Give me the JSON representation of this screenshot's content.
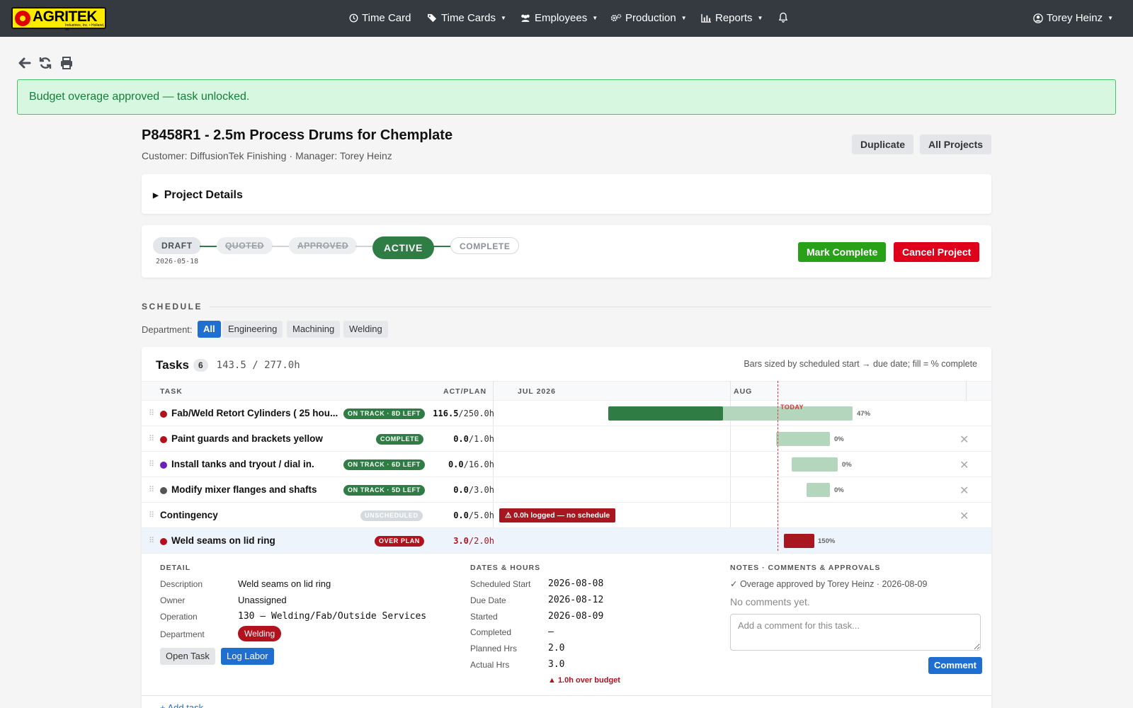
{
  "app": {
    "brand": "AGRITEK",
    "brand_tagline": "Industries, Inc. • Holland, MI"
  },
  "nav": {
    "items": [
      {
        "label": "Time Card",
        "icon": "clock-icon",
        "has_caret": false
      },
      {
        "label": "Time Cards",
        "icon": "tags-icon",
        "has_caret": true
      },
      {
        "label": "Employees",
        "icon": "users-icon",
        "has_caret": true
      },
      {
        "label": "Production",
        "icon": "gears-icon",
        "has_caret": true
      },
      {
        "label": "Reports",
        "icon": "bar-chart-icon",
        "has_caret": true
      }
    ],
    "user": "Torey Heinz"
  },
  "alert": {
    "message": "Budget overage approved — task unlocked.",
    "color": "#167d3a"
  },
  "project": {
    "title": "P8458R1 - 2.5m Process Drums for Chemplate",
    "customer_label": "Customer: DiffusionTek Finishing",
    "separator": "·",
    "manager_label": "Manager: Torey Heinz",
    "duplicate_label": "Duplicate",
    "all_projects_label": "All Projects",
    "details_label": "Project Details"
  },
  "status": {
    "stages": [
      "DRAFT",
      "QUOTED",
      "APPROVED",
      "ACTIVE",
      "COMPLETE"
    ],
    "current": "ACTIVE",
    "draft_date": "2026-05-18",
    "mark_complete_label": "Mark Complete",
    "cancel_label": "Cancel Project"
  },
  "schedule": {
    "heading": "SCHEDULE",
    "department_label": "Department:",
    "departments": [
      "All",
      "Engineering",
      "Machining",
      "Welding"
    ],
    "selected_department": "All"
  },
  "tasks": {
    "title": "Tasks",
    "count": "6",
    "hours_total": "143.5 / 277.0h",
    "bars_note": "Bars sized by scheduled start → due date; fill = % complete",
    "col_task": "TASK",
    "col_act_plan": "ACT/PLAN",
    "months": [
      "JUL 2026",
      "AUG"
    ],
    "today_label": "TODAY",
    "rows": [
      {
        "name": "Fab/Weld Retort Cylinders ( 25 hou...",
        "dot_color": "#b1121d",
        "badge": "ON TRACK · 8D LEFT",
        "badge_style": "green",
        "act": "116.5",
        "plan": "/250.0h",
        "pct": "47%",
        "pct_value": 47
      },
      {
        "name": "Paint guards and brackets yellow",
        "dot_color": "#b1121d",
        "badge": "COMPLETE",
        "badge_style": "green",
        "act": "0.0",
        "plan": "/1.0h",
        "pct": "0%",
        "pct_value": 0
      },
      {
        "name": "Install tanks and tryout / dial in.",
        "dot_color": "#6a1fb5",
        "badge": "ON TRACK · 6D LEFT",
        "badge_style": "green",
        "act": "0.0",
        "plan": "/16.0h",
        "pct": "0%",
        "pct_value": 0
      },
      {
        "name": "Modify mixer flanges and shafts",
        "dot_color": "#555555",
        "badge": "ON TRACK · 5D LEFT",
        "badge_style": "green",
        "act": "0.0",
        "plan": "/3.0h",
        "pct": "0%",
        "pct_value": 0
      },
      {
        "name": "Contingency",
        "dot_color": "",
        "badge": "UNSCHEDULED",
        "badge_style": "grey",
        "act": "0.0",
        "plan": "/5.0h",
        "warning": "⚠ 0.0h logged — no schedule"
      },
      {
        "name": "Weld seams on lid ring",
        "dot_color": "#b1121d",
        "badge": "OVER PLAN",
        "badge_style": "red",
        "act": "3.0",
        "plan": "/2.0h",
        "pct": "150%",
        "pct_value": 150
      }
    ],
    "add_task_label": "+ Add task"
  },
  "detail": {
    "heading_detail": "DETAIL",
    "heading_dates": "DATES & HOURS",
    "heading_notes": "NOTES · COMMENTS & APPROVALS",
    "description_label": "Description",
    "description": "Weld seams on lid ring",
    "owner_label": "Owner",
    "owner": "Unassigned",
    "operation_label": "Operation",
    "operation": "130 — Welding/Fab/Outside Services",
    "department_label": "Department",
    "department": "Welding",
    "open_task_label": "Open Task",
    "log_labor_label": "Log Labor",
    "sched_start_label": "Scheduled Start",
    "sched_start": "2026-08-08",
    "due_label": "Due Date",
    "due": "2026-08-12",
    "started_label": "Started",
    "started": "2026-08-09",
    "completed_label": "Completed",
    "completed": "—",
    "planned_label": "Planned Hrs",
    "planned": "2.0",
    "actual_label": "Actual Hrs",
    "actual": "3.0",
    "over_budget": "▲ 1.0h over budget",
    "approval_note": "✓ Overage approved by Torey Heinz · 2026-08-09",
    "no_comments": "No comments yet.",
    "comment_placeholder": "Add a comment for this task...",
    "comment_button": "Comment"
  }
}
